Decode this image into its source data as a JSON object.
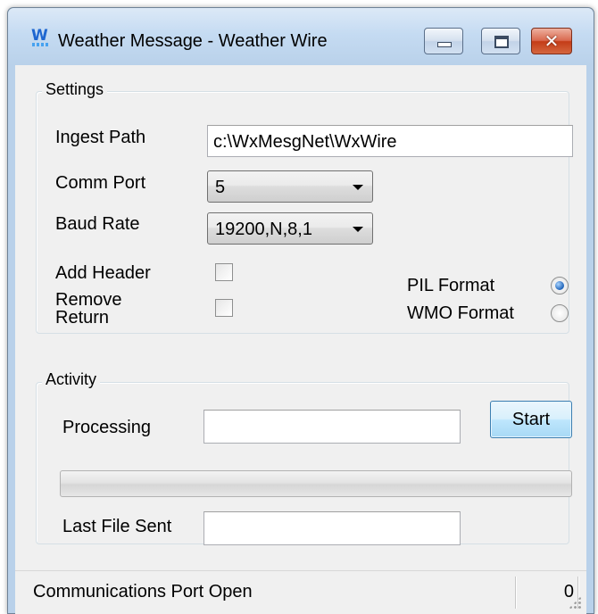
{
  "window": {
    "title": "Weather Message - Weather Wire",
    "icon": "weather-message-app-icon",
    "icon_letter": "W"
  },
  "settings": {
    "group_title": "Settings",
    "ingest_path_label": "Ingest Path",
    "ingest_path_value": "c:\\WxMesgNet\\WxWire",
    "comm_port_label": "Comm Port",
    "comm_port_value": "5",
    "baud_rate_label": "Baud Rate",
    "baud_rate_value": "19200,N,8,1",
    "add_header_label": "Add Header",
    "add_header_checked": false,
    "remove_return_label_line1": "Remove",
    "remove_return_label_line2": "Return",
    "remove_return_checked": false,
    "pil_format_label": "PIL Format",
    "pil_format_selected": true,
    "wmo_format_label": "WMO Format",
    "wmo_format_selected": false
  },
  "activity": {
    "group_title": "Activity",
    "processing_label": "Processing",
    "processing_value": "",
    "start_button_label": "Start",
    "progress_value": 0,
    "last_file_sent_label": "Last File Sent",
    "last_file_sent_value": ""
  },
  "statusbar": {
    "message": "Communications Port Open",
    "count": "0"
  },
  "colors": {
    "window_frame": "#b9d1ea",
    "client_background": "#f0f0f0",
    "close_button": "#c43c17",
    "radio_selected": "#1f63b8"
  }
}
